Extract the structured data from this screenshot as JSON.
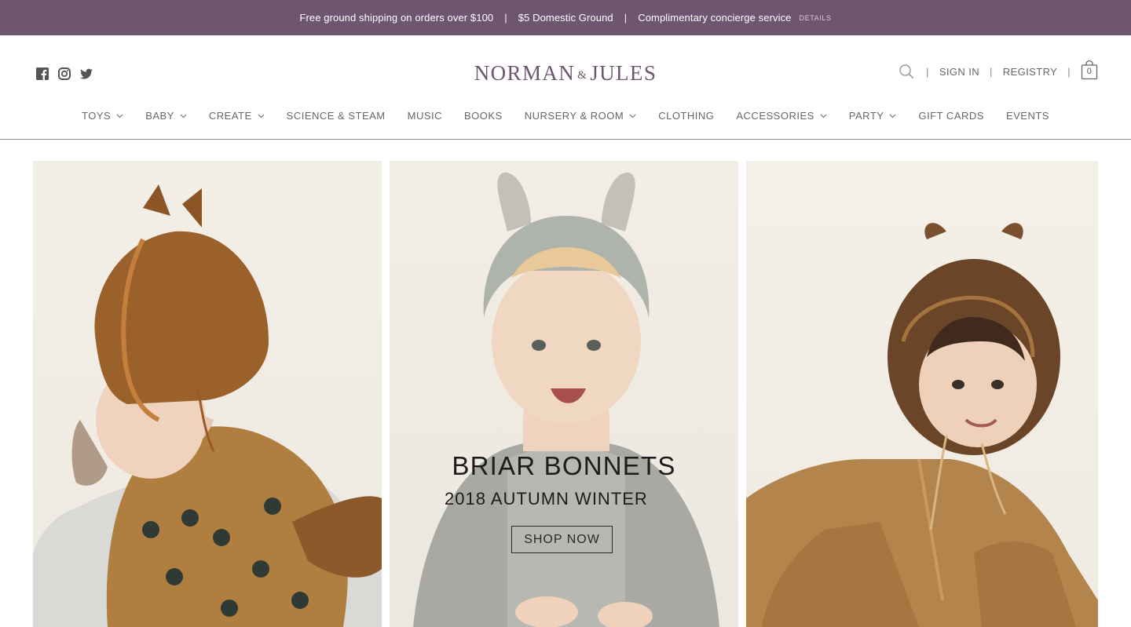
{
  "promo_bar": {
    "shipping": "Free ground shipping on orders over $100",
    "separator": "|",
    "domestic": "$5 Domestic Ground",
    "concierge": "Complimentary concierge service",
    "details_link": "DETAILS",
    "background_color": "#6e5670"
  },
  "header": {
    "logo": {
      "left": "NORMAN",
      "amp": "&",
      "right": "JULES",
      "color": "#6e5670"
    },
    "social_icons": [
      "facebook-icon",
      "instagram-icon",
      "twitter-icon"
    ],
    "utility": {
      "search_icon": "search-icon",
      "sign_in": "SIGN IN",
      "registry": "REGISTRY",
      "separator": "|",
      "cart_count": "0"
    }
  },
  "nav": {
    "items": [
      {
        "label": "TOYS",
        "has_dropdown": true
      },
      {
        "label": "BABY",
        "has_dropdown": true
      },
      {
        "label": "CREATE",
        "has_dropdown": true
      },
      {
        "label": "SCIENCE & STEAM",
        "has_dropdown": false
      },
      {
        "label": "MUSIC",
        "has_dropdown": false
      },
      {
        "label": "BOOKS",
        "has_dropdown": false
      },
      {
        "label": "NURSERY & ROOM",
        "has_dropdown": true
      },
      {
        "label": "CLOTHING",
        "has_dropdown": false
      },
      {
        "label": "ACCESSORIES",
        "has_dropdown": true
      },
      {
        "label": "PARTY",
        "has_dropdown": true
      },
      {
        "label": "GIFT CARDS",
        "has_dropdown": false
      },
      {
        "label": "EVENTS",
        "has_dropdown": false
      }
    ]
  },
  "hero": {
    "headline": "BRIAR BONNETS",
    "subheadline": "2018 AUTUMN WINTER",
    "cta": "SHOP NOW"
  }
}
